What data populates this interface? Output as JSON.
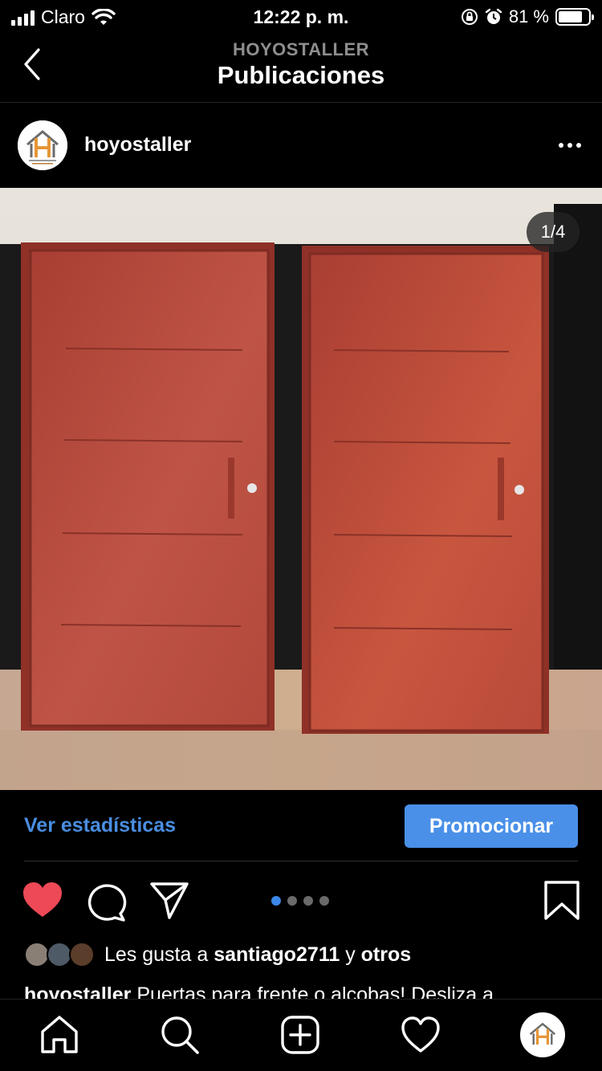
{
  "status_bar": {
    "carrier": "Claro",
    "time": "12:22 p. m.",
    "battery_percent": "81 %",
    "battery_level": 0.81,
    "icons": [
      "signal-icon",
      "wifi-icon",
      "orientation-lock-icon",
      "alarm-icon",
      "battery-icon"
    ]
  },
  "header": {
    "account": "HOYOSTALLER",
    "title": "Publicaciones"
  },
  "post": {
    "username": "hoyostaller",
    "counter": "1/4",
    "current_slide": 1,
    "total_slides": 4
  },
  "insights": {
    "view_stats": "Ver estadísticas",
    "promote": "Promocionar"
  },
  "likes": {
    "prefix": "Les gusta a",
    "user": "santiago2711",
    "joiner": "y",
    "others": "otros"
  },
  "caption": {
    "username": "hoyostaller",
    "text": "Puertas para frente o alcobas! Desliza a"
  },
  "colors": {
    "accent_blue": "#4a90e8",
    "like_red": "#ed4956",
    "door": "#b4473a"
  }
}
